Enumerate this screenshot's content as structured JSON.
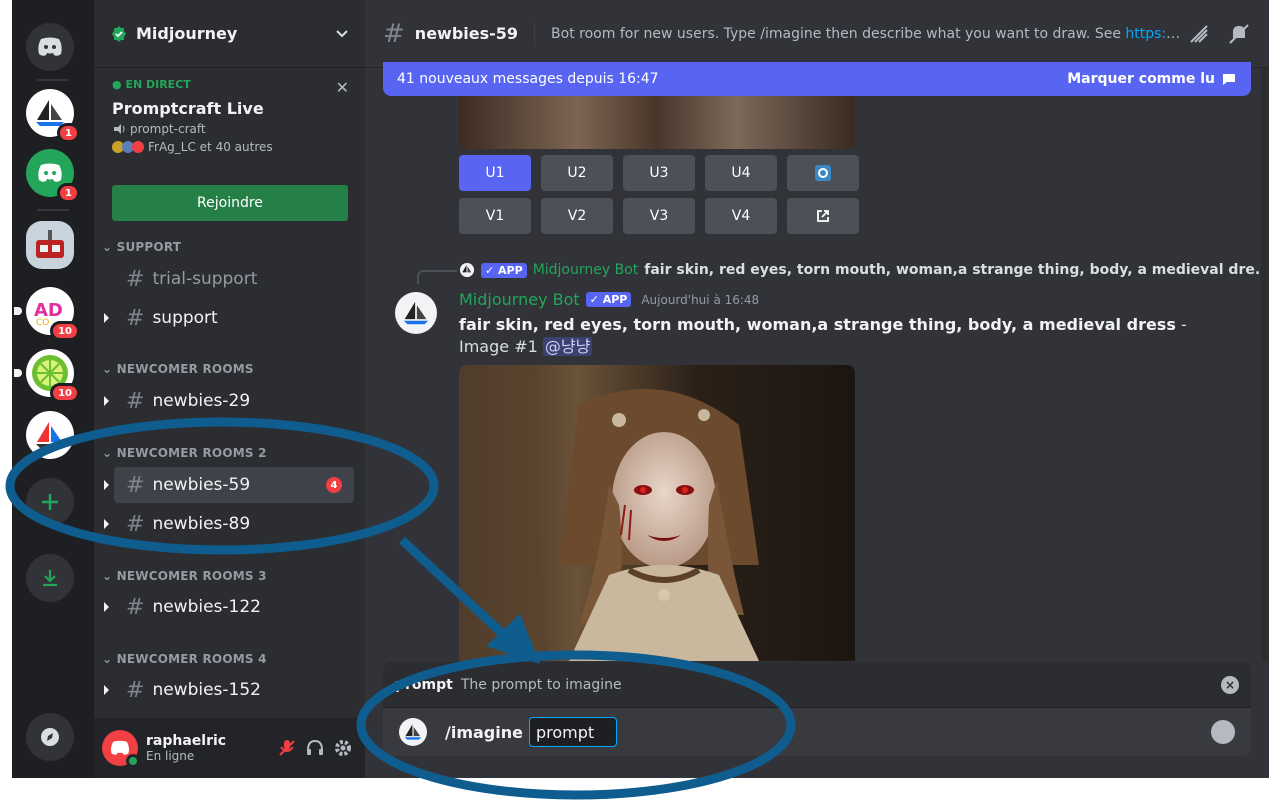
{
  "server": {
    "name": "Midjourney",
    "badges": [
      "1",
      "1",
      "10",
      "10"
    ]
  },
  "live": {
    "tag": "EN DIRECT",
    "title": "Promptcraft Live",
    "channel": "prompt-craft",
    "participants": "FrAg_LC et 40 autres",
    "join_label": "Rejoindre"
  },
  "categories": {
    "support": "SUPPORT",
    "newcomer": "NEWCOMER ROOMS",
    "newcomer2": "NEWCOMER ROOMS 2",
    "newcomer3": "NEWCOMER ROOMS 3",
    "newcomer4": "NEWCOMER ROOMS 4"
  },
  "channels": {
    "trial_support": "trial-support",
    "support": "support",
    "newbies_29": "newbies-29",
    "newbies_59": "newbies-59",
    "newbies_59_badge": "4",
    "newbies_89": "newbies-89",
    "newbies_122": "newbies-122",
    "newbies_152": "newbies-152"
  },
  "user": {
    "name": "raphaelric",
    "status": "En ligne"
  },
  "topbar": {
    "channel": "newbies-59",
    "topic": "Bot room for new users. Type /imagine then describe what you want to draw. See ",
    "topic_link": "https://d..."
  },
  "banner": {
    "text": "41 nouveaux messages depuis 16:47",
    "action": "Marquer comme lu"
  },
  "buttons": {
    "row1": [
      "U1",
      "U2",
      "U3",
      "U4"
    ],
    "row2": [
      "V1",
      "V2",
      "V3",
      "V4"
    ]
  },
  "reply": {
    "app": "APP",
    "author": "Midjourney Bot",
    "text": "fair skin, red eyes, torn mouth, woman,a strange thing, body, a medieval dre..."
  },
  "message": {
    "author": "Midjourney Bot",
    "app": "APP",
    "time": "Aujourd'hui à 16:48",
    "prompt": "fair skin, red eyes, torn mouth, woman,a strange thing, body, a medieval dress",
    "suffix": " - Image #1 ",
    "mention": "@냥냥"
  },
  "command": {
    "option_name": "prompt",
    "option_desc": "The prompt to imagine",
    "cmd": "/imagine",
    "arg": "prompt"
  },
  "colors": {
    "brand": "#5865f2",
    "green": "#23a55a",
    "red": "#f23f43",
    "annotation": "#0f5c8f"
  }
}
